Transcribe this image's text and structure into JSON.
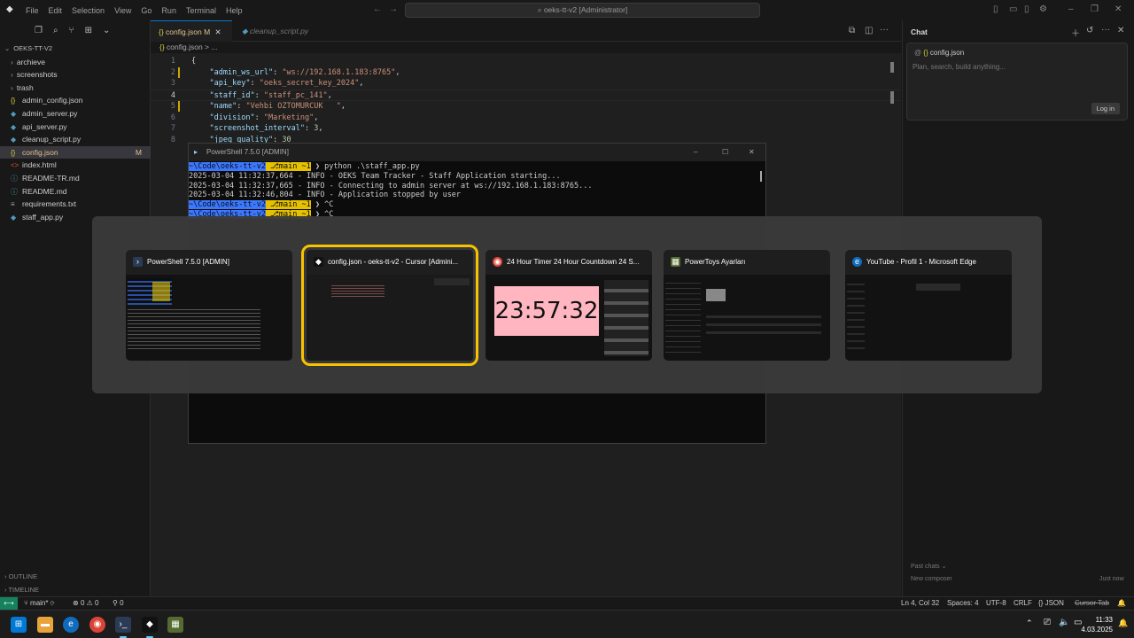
{
  "titlebar": {
    "menu": [
      "File",
      "Edit",
      "Selection",
      "View",
      "Go",
      "Run",
      "Terminal",
      "Help"
    ],
    "search": "oeks-tt-v2 [Administrator]"
  },
  "explorer": {
    "root": "OEKS-TT-V2",
    "items": [
      {
        "label": "archieve",
        "type": "folder"
      },
      {
        "label": "screenshots",
        "type": "folder"
      },
      {
        "label": "trash",
        "type": "folder"
      },
      {
        "label": "admin_config.json",
        "type": "json"
      },
      {
        "label": "admin_server.py",
        "type": "py"
      },
      {
        "label": "api_server.py",
        "type": "py"
      },
      {
        "label": "cleanup_script.py",
        "type": "py"
      },
      {
        "label": "config.json",
        "type": "json",
        "badge": "M"
      },
      {
        "label": "index.html",
        "type": "html"
      },
      {
        "label": "README-TR.md",
        "type": "md"
      },
      {
        "label": "README.md",
        "type": "md"
      },
      {
        "label": "requirements.txt",
        "type": "txt"
      },
      {
        "label": "staff_app.py",
        "type": "py"
      }
    ],
    "outline": "OUTLINE",
    "timeline": "TIMELINE"
  },
  "editor": {
    "tabs": [
      {
        "label": "config.json",
        "modified": "M"
      },
      {
        "label": "cleanup_script.py"
      }
    ],
    "breadcrumb": "config.json > ...",
    "lines": [
      {
        "n": "1",
        "text": "{"
      },
      {
        "n": "2",
        "key": "\"admin_ws_url\"",
        "val": "\"ws://192.168.1.183:8765\""
      },
      {
        "n": "3",
        "key": "\"api_key\"",
        "val": "\"oeks_secret_key_2024\""
      },
      {
        "n": "4",
        "key": "\"staff_id\"",
        "val": "\"staff_pc_141\""
      },
      {
        "n": "5",
        "key": "\"name\"",
        "val": "\"Vehbi OZTOMURCUK   \""
      },
      {
        "n": "6",
        "key": "\"division\"",
        "val": "\"Marketing\""
      },
      {
        "n": "7",
        "key": "\"screenshot_interval\"",
        "num": "3"
      },
      {
        "n": "8",
        "key": "\"jpeg_quality\"",
        "num": "30"
      }
    ]
  },
  "powershell": {
    "title": "PowerShell 7.5.0 [ADMIN]",
    "prompt_path": "~\\Code\\oeks-tt-v2",
    "branch": "main",
    "changes": "~1",
    "command": "python .\\staff_app.py",
    "logs": [
      "2025-03-04 11:32:37,664 - INFO - OEKS Team Tracker - Staff Application starting...",
      "2025-03-04 11:32:37,665 - INFO - Connecting to admin server at ws://192.168.1.183:8765...",
      "2025-03-04 11:32:46,804 - INFO - Application stopped by user"
    ],
    "ctrl_c": "^C"
  },
  "chat": {
    "title": "Chat",
    "context": "config.json",
    "placeholder": "Plan, search, build anything...",
    "login": "Log in",
    "past_chats": "Past chats",
    "new_composer": "New composer",
    "just_now": "Just now"
  },
  "statusbar": {
    "branch": "main*",
    "problems": "0",
    "warnings": "0",
    "ports": "0",
    "position": "Ln 4, Col 32",
    "spaces": "Spaces: 4",
    "encoding": "UTF-8",
    "eol": "CRLF",
    "language": "JSON",
    "cursor_tab": "Cursor Tab"
  },
  "alttab": {
    "windows": [
      {
        "title": "PowerShell 7.5.0 [ADMIN]",
        "icon": "powershell-icon"
      },
      {
        "title": "config.json - oeks-tt-v2 - Cursor [Admini...",
        "icon": "cursor-icon",
        "selected": true
      },
      {
        "title": "24 Hour Timer 24 Hour Countdown 24 S...",
        "icon": "chrome-icon",
        "timer": "23:57:32"
      },
      {
        "title": "PowerToys Ayarları",
        "icon": "powertoys-icon"
      },
      {
        "title": "YouTube - Profil 1 - Microsoft Edge",
        "icon": "edge-icon"
      }
    ]
  },
  "taskbar": {
    "time": "11:33",
    "date": "4.03.2025"
  },
  "colors": {
    "accent": "#0078d4",
    "selection_outline": "#f7c300",
    "modified": "#e2c08d",
    "remote": "#16825d"
  }
}
